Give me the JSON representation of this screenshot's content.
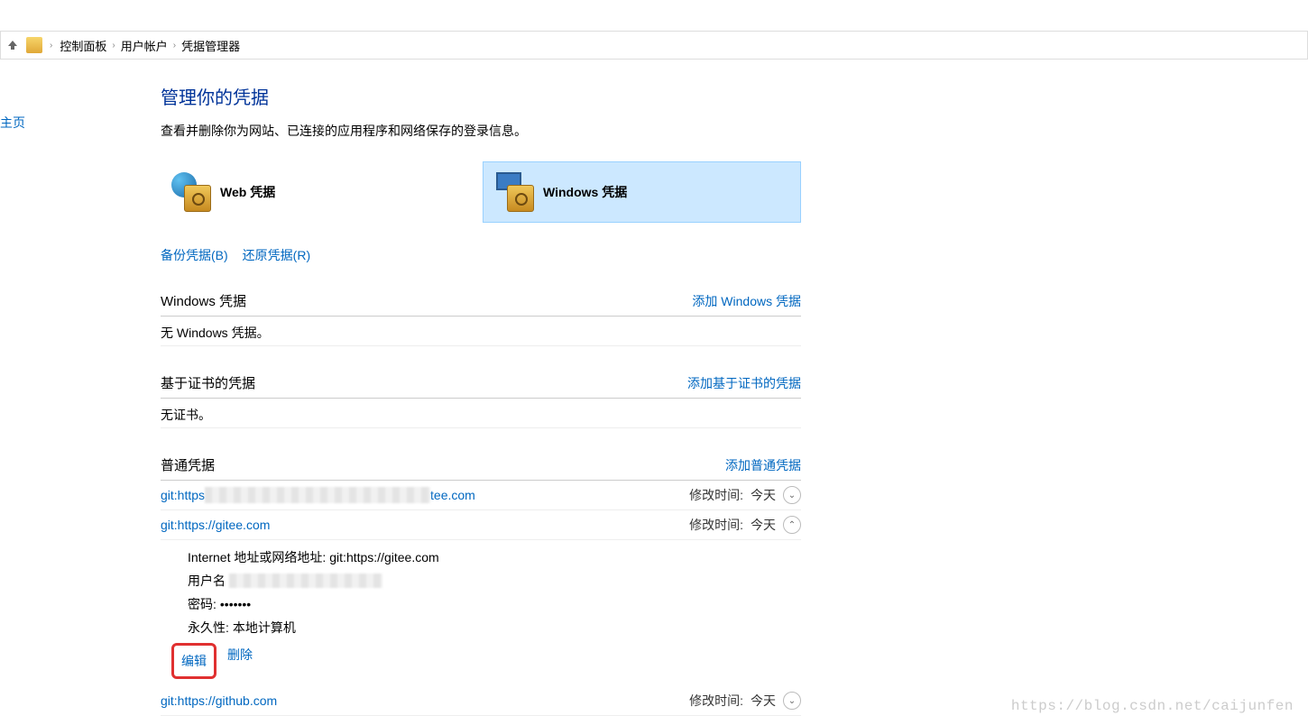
{
  "breadcrumb": {
    "items": [
      "控制面板",
      "用户帐户",
      "凭据管理器"
    ]
  },
  "sidebar": {
    "home_link": "主页"
  },
  "header": {
    "title": "管理你的凭据",
    "subtitle": "查看并删除你为网站、已连接的应用程序和网络保存的登录信息。"
  },
  "categories": {
    "web": "Web 凭据",
    "windows": "Windows 凭据"
  },
  "top_links": {
    "backup": "备份凭据(B)",
    "restore": "还原凭据(R)"
  },
  "sections": {
    "windows": {
      "title": "Windows 凭据",
      "add": "添加 Windows 凭据",
      "empty": "无 Windows 凭据。"
    },
    "cert": {
      "title": "基于证书的凭据",
      "add": "添加基于证书的凭据",
      "empty": "无证书。"
    },
    "generic": {
      "title": "普通凭据",
      "add": "添加普通凭据",
      "items": [
        {
          "name_prefix": "git:https",
          "name_suffix": "tee.com",
          "blurred": true,
          "mod_label": "修改时间:",
          "mod_val": "今天",
          "expanded": false
        },
        {
          "name": "git:https://gitee.com",
          "mod_label": "修改时间:",
          "mod_val": "今天",
          "expanded": true,
          "detail": {
            "addr_label": "Internet 地址或网络地址:",
            "addr_val": "git:https://gitee.com",
            "user_label": "用户名",
            "pw_label": "密码:",
            "pw_val": "•••••••",
            "persist_label": "永久性:",
            "persist_val": "本地计算机",
            "edit": "编辑",
            "delete": "删除"
          }
        },
        {
          "name": "git:https://github.com",
          "mod_label": "修改时间:",
          "mod_val": "今天",
          "expanded": false
        }
      ]
    }
  },
  "watermark": "https://blog.csdn.net/caijunfen"
}
